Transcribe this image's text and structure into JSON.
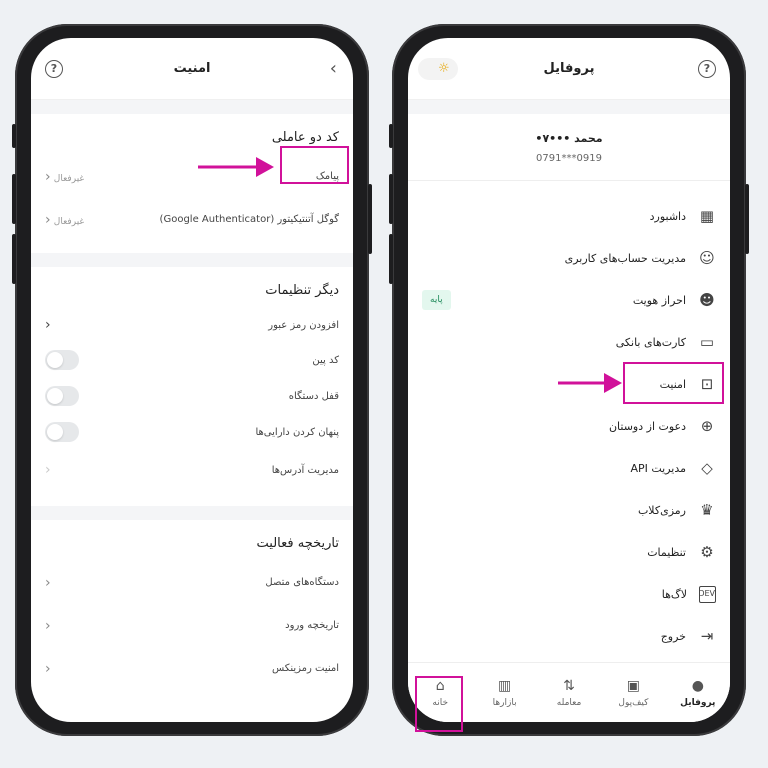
{
  "left": {
    "title": "امنیت",
    "section1": {
      "title": "کد دو عاملی",
      "rows": [
        {
          "label": "پیامک",
          "status": "غیرفعال"
        },
        {
          "label": "گوگل آتنتیکیتور (Google Authenticator)",
          "status": "غیرفعال"
        }
      ]
    },
    "section2": {
      "title": "دیگر تنظیمات",
      "rows": [
        {
          "label": "افزودن رمز عبور"
        },
        {
          "label": "کد پین"
        },
        {
          "label": "قفل دستگاه"
        },
        {
          "label": "پنهان کردن دارایی‌ها"
        },
        {
          "label": "مدیریت آدرس‌ها"
        }
      ]
    },
    "section3": {
      "title": "تاریخچه فعالیت",
      "rows": [
        {
          "label": "دستگاه‌های متصل"
        },
        {
          "label": "تاریخچه ورود"
        },
        {
          "label": "امنیت رمزینکس"
        }
      ]
    }
  },
  "right": {
    "title": "پروفایل",
    "profile": {
      "name": "محمد •••۷•",
      "phone": "0919***0791"
    },
    "menu": [
      {
        "label": "داشبورد",
        "icon": "grid-icon"
      },
      {
        "label": "مدیریت حساب‌های کاربری",
        "icon": "user-icon"
      },
      {
        "label": "احراز هویت",
        "icon": "face-icon",
        "badge": "پایه"
      },
      {
        "label": "کارت‌های بانکی",
        "icon": "card-icon"
      },
      {
        "label": "امنیت",
        "icon": "lock-icon"
      },
      {
        "label": "دعوت از دوستان",
        "icon": "user-plus-icon"
      },
      {
        "label": "مدیریت API",
        "icon": "code-icon"
      },
      {
        "label": "رمزی‌کلاب",
        "icon": "trophy-icon"
      },
      {
        "label": "تنظیمات",
        "icon": "gear-icon"
      },
      {
        "label": "لاگ‌ها",
        "icon": "dev-icon"
      },
      {
        "label": "خروج",
        "icon": "logout-icon"
      }
    ],
    "nav": [
      {
        "label": "خانه",
        "icon": "home-icon"
      },
      {
        "label": "بازارها",
        "icon": "chart-icon"
      },
      {
        "label": "معامله",
        "icon": "exchange-icon"
      },
      {
        "label": "کیف‌پول",
        "icon": "wallet-icon"
      },
      {
        "label": "پروفایل",
        "icon": "profile-icon"
      }
    ]
  },
  "colors": {
    "highlight": "#d1119a",
    "badge_bg": "#e3f7ee",
    "badge_text": "#1e8a5a"
  }
}
